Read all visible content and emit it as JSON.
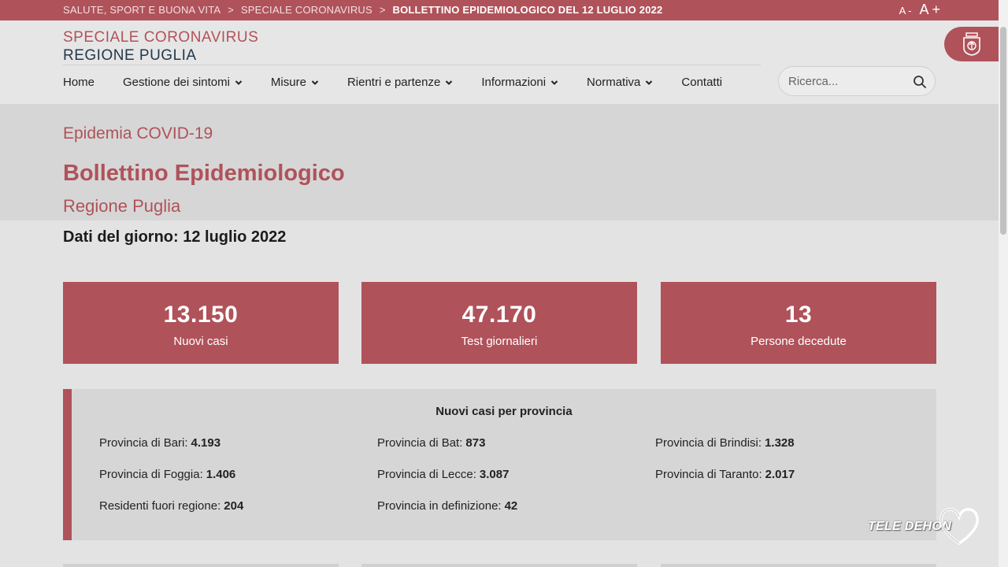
{
  "breadcrumb": {
    "items": [
      "SALUTE, SPORT E BUONA VITA",
      "SPECIALE CORONAVIRUS",
      "BOLLETTINO EPIDEMIOLOGICO DEL 12 LUGLIO 2022"
    ],
    "separator": ">"
  },
  "font_controls": {
    "decrease": "A -",
    "increase": "A +"
  },
  "site": {
    "title_line1": "SPECIALE CORONAVIRUS",
    "title_line2": "REGIONE PUGLIA"
  },
  "nav": {
    "items": [
      {
        "label": "Home",
        "has_dropdown": false
      },
      {
        "label": "Gestione dei sintomi",
        "has_dropdown": true
      },
      {
        "label": "Misure",
        "has_dropdown": true
      },
      {
        "label": "Rientri e partenze",
        "has_dropdown": true
      },
      {
        "label": "Informazioni",
        "has_dropdown": true
      },
      {
        "label": "Normativa",
        "has_dropdown": true
      },
      {
        "label": "Contatti",
        "has_dropdown": false
      }
    ]
  },
  "search": {
    "placeholder": "Ricerca...",
    "value": "",
    "icon": "search-icon"
  },
  "hero": {
    "kicker": "Epidemia COVID-19",
    "title": "Bollettino Epidemiologico",
    "subtitle": "Regione Puglia"
  },
  "date_line": "Dati del giorno: 12 luglio 2022",
  "stats": [
    {
      "value": "13.150",
      "label": "Nuovi casi"
    },
    {
      "value": "47.170",
      "label": "Test giornalieri"
    },
    {
      "value": "13",
      "label": "Persone decedute"
    }
  ],
  "provinces": {
    "title": "Nuovi casi per provincia",
    "items": [
      {
        "label": "Provincia di Bari:",
        "value": "4.193"
      },
      {
        "label": "Provincia di Bat:",
        "value": "873"
      },
      {
        "label": "Provincia di Brindisi:",
        "value": "1.328"
      },
      {
        "label": "Provincia di Foggia:",
        "value": "1.406"
      },
      {
        "label": "Provincia di Lecce:",
        "value": "3.087"
      },
      {
        "label": "Provincia di Taranto:",
        "value": "2.017"
      },
      {
        "label": "Residenti fuori regione:",
        "value": "204"
      },
      {
        "label": "Provincia in definizione:",
        "value": "42"
      }
    ]
  },
  "watermark": {
    "text": "TELE DEHON"
  },
  "colors": {
    "accent": "#b0525a",
    "navy": "#24384a",
    "background": "#e3e3e3",
    "panel": "#d6d6d6"
  }
}
